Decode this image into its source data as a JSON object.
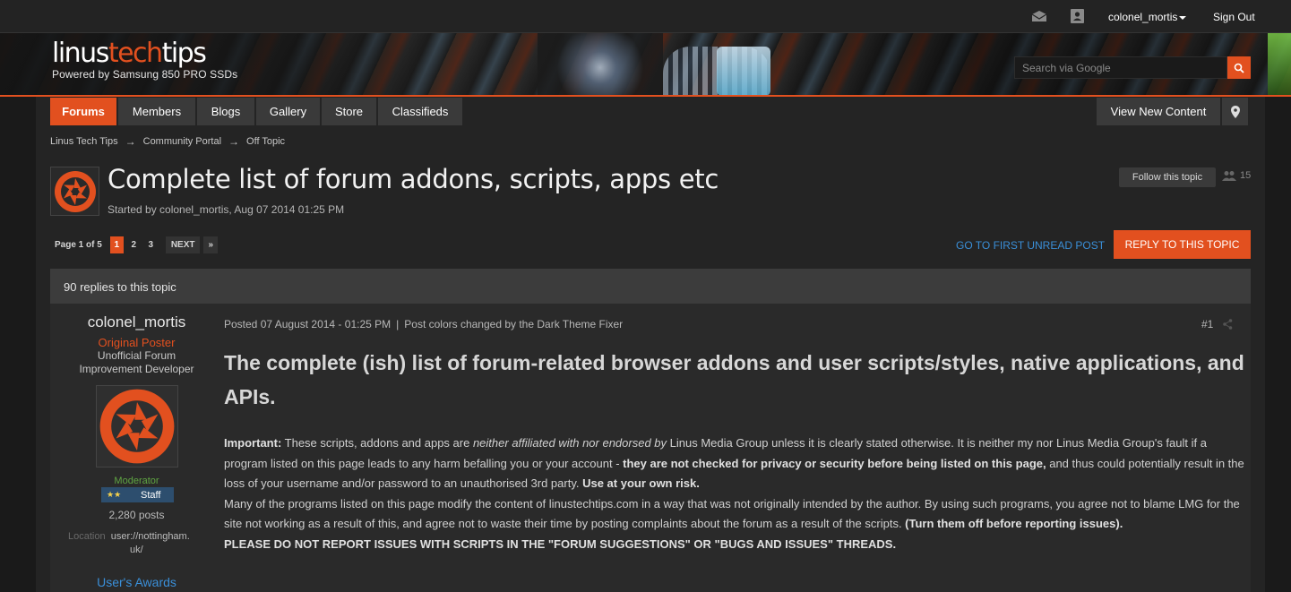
{
  "colors": {
    "accent": "#e2501f",
    "link": "#3a8fd8",
    "moderator_green": "#5fa542",
    "rank_blue": "#2d4e6e"
  },
  "userbar": {
    "icons": [
      "mail-icon",
      "notifications-icon"
    ],
    "username": "colonel_mortis",
    "sign_out": "Sign Out"
  },
  "header": {
    "logo_left": "linus",
    "logo_accent": "tech",
    "logo_right": "tips",
    "logo_sub": "Powered by Samsung 850 PRO SSDs",
    "search_placeholder": "Search via Google",
    "search_icon": "search-icon"
  },
  "nav": {
    "tabs": [
      {
        "label": "Forums",
        "active": true
      },
      {
        "label": "Members",
        "active": false
      },
      {
        "label": "Blogs",
        "active": false
      },
      {
        "label": "Gallery",
        "active": false
      },
      {
        "label": "Store",
        "active": false
      },
      {
        "label": "Classifieds",
        "active": false
      }
    ],
    "view_new_content": "View New Content",
    "pin_icon": "map-pin-icon"
  },
  "breadcrumb": [
    "Linus Tech Tips",
    "Community Portal",
    "Off Topic"
  ],
  "breadcrumb_separator": "→",
  "topic": {
    "title": "Complete list of forum addons, scripts, apps etc",
    "started_by": "Started by colonel_mortis, Aug 07 2014 01:25 PM",
    "follow_label": "Follow this topic",
    "followers": "15"
  },
  "pagination": {
    "label": "Page 1 of 5",
    "pages": [
      "1",
      "2",
      "3"
    ],
    "current": "1",
    "next": "NEXT",
    "last": "»"
  },
  "actions": {
    "first_unread": "GO TO FIRST UNREAD POST",
    "reply": "REPLY TO THIS TOPIC"
  },
  "replies_count_text": "90 replies to this topic",
  "post": {
    "author": {
      "name": "colonel_mortis",
      "badge": "Original Poster",
      "title_line1": "Unofficial Forum",
      "title_line2": "Improvement Developer",
      "group": "Moderator",
      "rank_stars": "★★",
      "rank_label": "Staff",
      "posts": "2,280 posts",
      "location_label": "Location",
      "location_value_1": "user://nottingham.",
      "location_value_2": "uk/",
      "awards": "User's Awards"
    },
    "posted": "Posted 07 August 2014 - 01:25 PM",
    "meta_sep": "|",
    "meta_note": "Post colors changed by the Dark Theme Fixer",
    "number": "#1",
    "heading": "The complete (ish) list of forum-related browser addons and user scripts/styles, native applications, and APIs.",
    "p1_b1": "Important:",
    "p1_t1": " These scripts, addons and apps are ",
    "p1_i1": "neither affiliated with nor endorsed by",
    "p1_t2": " Linus Media Group unless it is clearly stated otherwise. It is neither my nor Linus Media Group's fault if a program listed on this page leads to any harm befalling you or your account - ",
    "p1_b2": "they are not checked for privacy or security before being listed on this page,",
    "p1_t3": " and thus could potentially result in the loss of your username and/or password to an unauthorised 3rd party. ",
    "p1_b3": "Use at your own risk.",
    "p2_t1": "Many of the programs listed on this page modify the content of linustechtips.com in a way that was not originally intended by the author. By using such programs, you agree not to blame LMG for the site not working as a result of this, and agree not to waste their time by posting complaints about the forum as a result of the scripts. ",
    "p2_b1": "(Turn them off before reporting issues).",
    "p3": "PLEASE DO NOT REPORT ISSUES WITH SCRIPTS IN THE \"FORUM SUGGESTIONS\" OR \"BUGS AND ISSUES\" THREADS."
  }
}
